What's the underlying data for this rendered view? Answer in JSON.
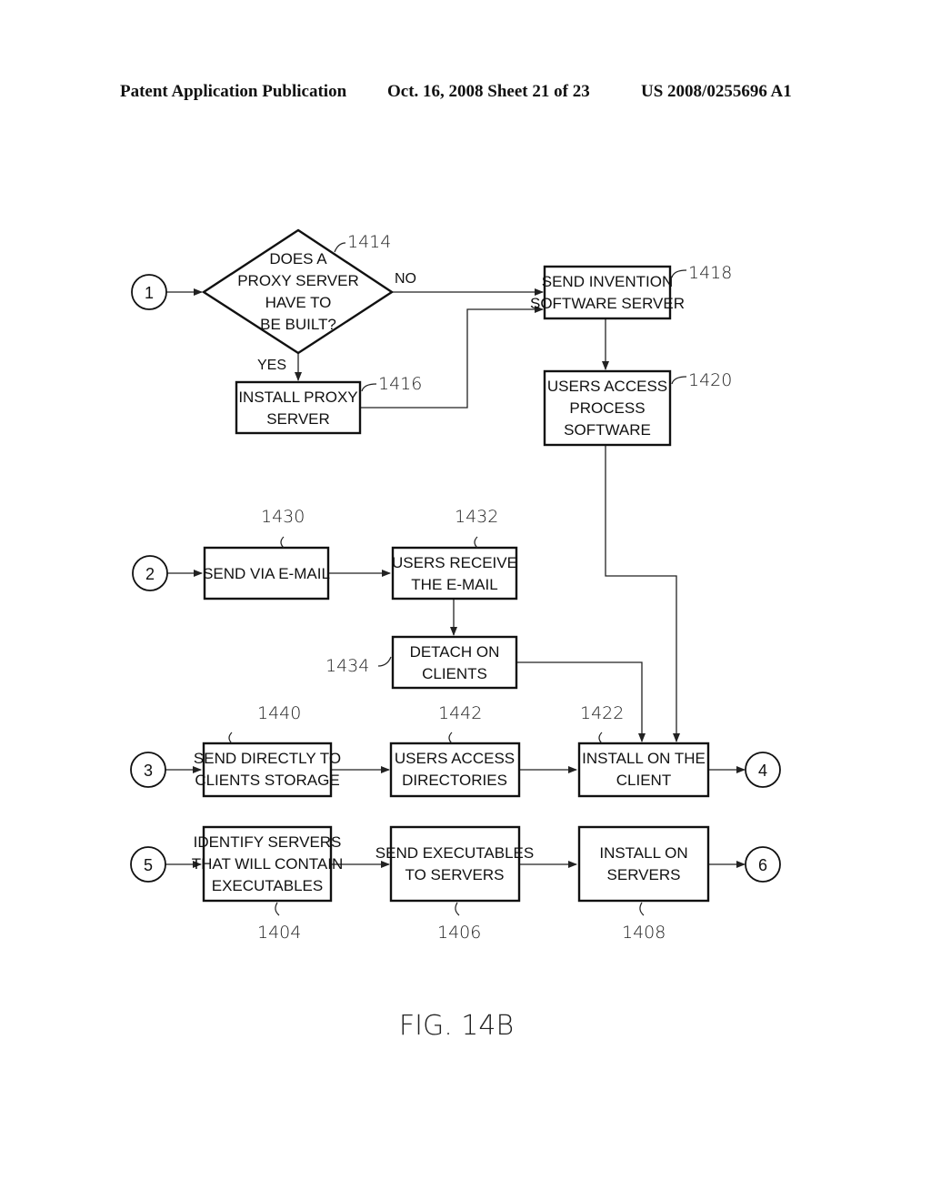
{
  "header": {
    "left": "Patent Application Publication",
    "middle": "Oct. 16, 2008  Sheet 21 of 23",
    "right": "US 2008/0255696 A1"
  },
  "connectors": {
    "c1": "1",
    "c2": "2",
    "c3": "3",
    "c4": "4",
    "c5": "5",
    "c6": "6"
  },
  "nodes": {
    "n1414": {
      "ref": "1414",
      "lines": [
        "DOES A",
        "PROXY SERVER",
        "HAVE TO",
        "BE BUILT?"
      ]
    },
    "n1416": {
      "ref": "1416",
      "lines": [
        "INSTALL PROXY",
        "SERVER"
      ]
    },
    "n1418": {
      "ref": "1418",
      "lines": [
        "SEND INVENTION",
        "SOFTWARE SERVER"
      ]
    },
    "n1420": {
      "ref": "1420",
      "lines": [
        "USERS ACCESS",
        "PROCESS",
        "SOFTWARE"
      ]
    },
    "n1430": {
      "ref": "1430",
      "lines": [
        "SEND VIA E-MAIL"
      ]
    },
    "n1432": {
      "ref": "1432",
      "lines": [
        "USERS RECEIVE",
        "THE E-MAIL"
      ]
    },
    "n1434": {
      "ref": "1434",
      "lines": [
        "DETACH ON",
        "CLIENTS"
      ]
    },
    "n1440": {
      "ref": "1440",
      "lines": [
        "SEND DIRECTLY TO",
        "CLIENTS STORAGE"
      ]
    },
    "n1442": {
      "ref": "1442",
      "lines": [
        "USERS ACCESS",
        "DIRECTORIES"
      ]
    },
    "n1422": {
      "ref": "1422",
      "lines": [
        "INSTALL ON THE",
        "CLIENT"
      ]
    },
    "n1404": {
      "ref": "1404",
      "lines": [
        "IDENTIFY SERVERS",
        "THAT WILL CONTAIN",
        "EXECUTABLES"
      ]
    },
    "n1406": {
      "ref": "1406",
      "lines": [
        "SEND EXECUTABLES",
        "TO SERVERS"
      ]
    },
    "n1408": {
      "ref": "1408",
      "lines": [
        "INSTALL ON",
        "SERVERS"
      ]
    }
  },
  "edge_labels": {
    "no": "NO",
    "yes": "YES"
  },
  "figure_label": "FIG. 14B"
}
